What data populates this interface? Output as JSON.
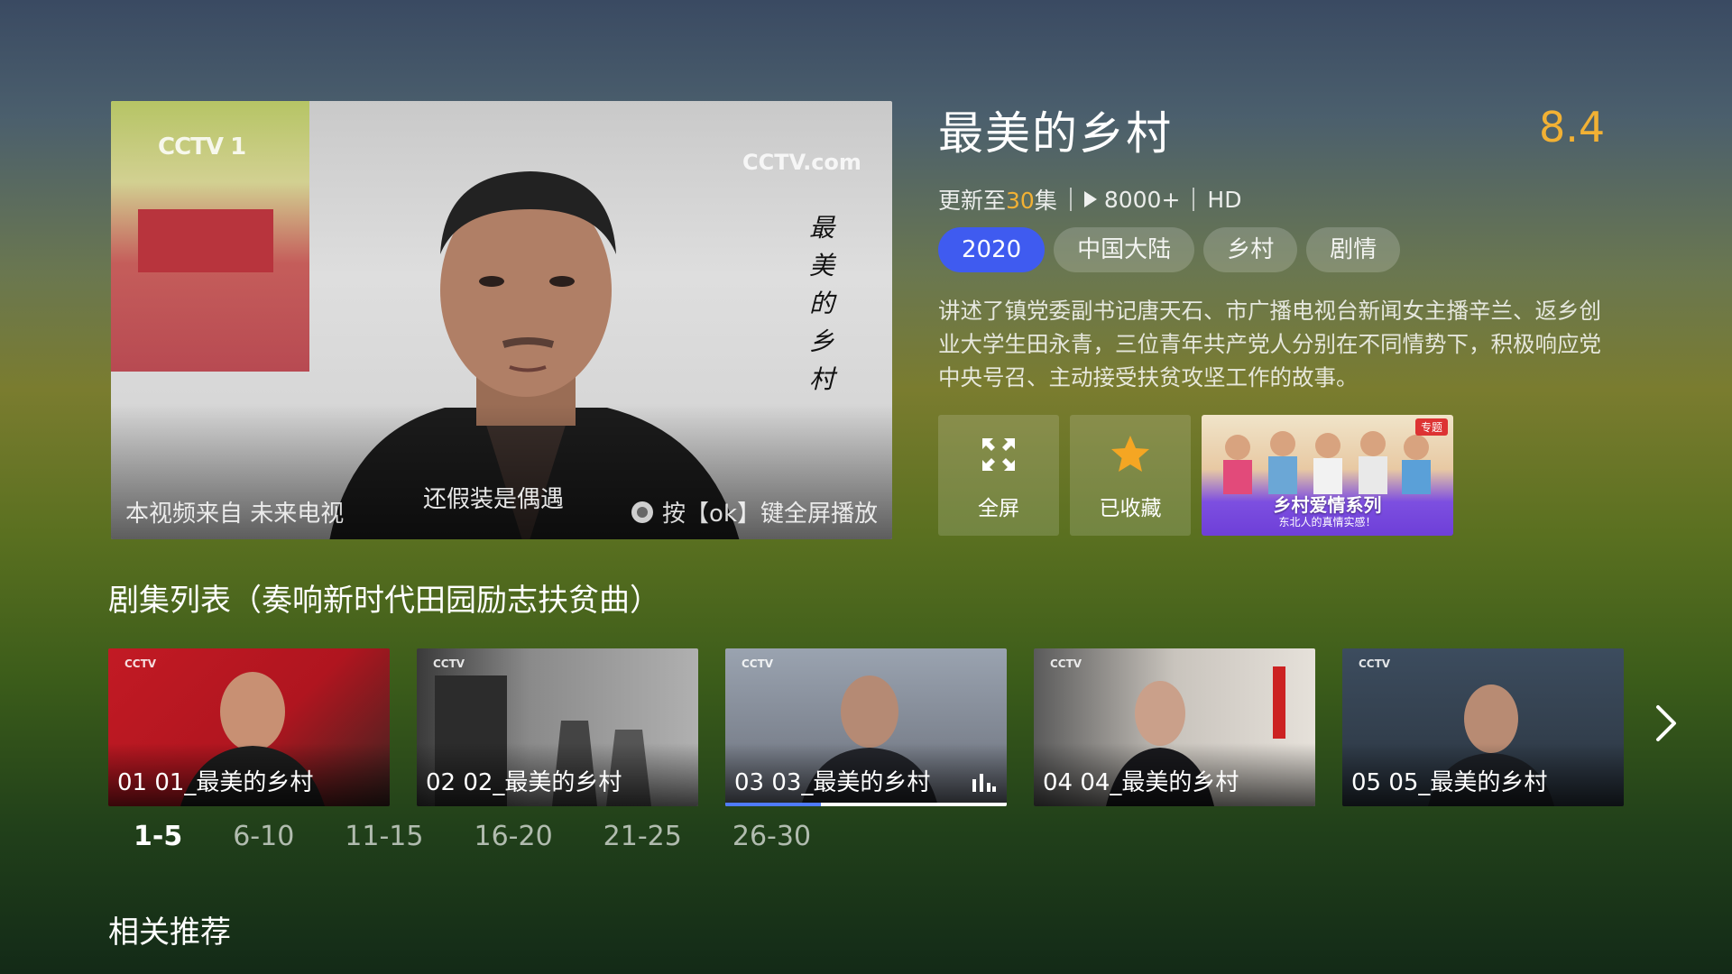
{
  "player": {
    "source_text": "本视频来自 未来电视",
    "subtitle": "还假装是偶遇",
    "ok_hint": "按【ok】键全屏播放",
    "watermark_left": "CCTV 1",
    "watermark_right": "CCTV.com",
    "vertical_title": "最美的乡村"
  },
  "show": {
    "title": "最美的乡村",
    "rating": "8.4",
    "update_prefix": "更新至",
    "update_count": "30",
    "update_suffix": "集",
    "plays": "8000+",
    "quality": "HD",
    "tags": [
      "2020",
      "中国大陆",
      "乡村",
      "剧情"
    ],
    "description": "讲述了镇党委副书记唐天石、市广播电视台新闻女主播辛兰、返乡创业大学生田永青，三位青年共产党人分别在不同情势下，积极响应党中央号召、主动接受扶贫攻坚工作的故事。"
  },
  "actions": {
    "fullscreen": "全屏",
    "favorite": "已收藏",
    "promo_badge": "专题",
    "promo_title": "乡村爱情系列",
    "promo_sub": "东北人的真情实感！"
  },
  "episodes": {
    "section_title": "剧集列表（奏响新时代田园励志扶贫曲）",
    "items": [
      {
        "label": "01 01_最美的乡村"
      },
      {
        "label": "02 02_最美的乡村"
      },
      {
        "label": "03 03_最美的乡村",
        "playing": true,
        "progress": 0.34
      },
      {
        "label": "04 04_最美的乡村"
      },
      {
        "label": "05 05_最美的乡村"
      }
    ],
    "ranges": [
      "1-5",
      "6-10",
      "11-15",
      "16-20",
      "21-25",
      "26-30"
    ],
    "selected_range": "1-5"
  },
  "related": {
    "title": "相关推荐"
  },
  "colors": {
    "accent": "#3f5bf0",
    "rating": "#f2b134",
    "progress": "#4f7bff"
  }
}
